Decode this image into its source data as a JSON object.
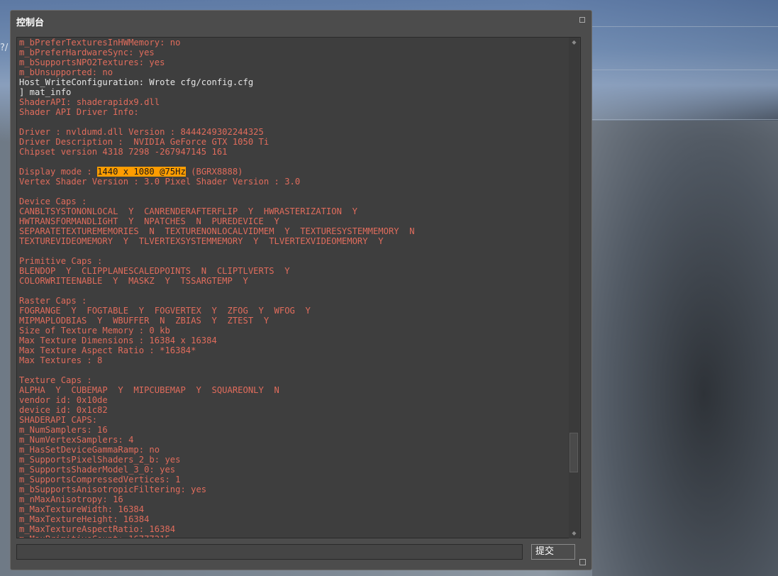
{
  "window": {
    "title": "控制台",
    "submit_label": "提交",
    "input_value": "",
    "highlight_color": "#ff9d00",
    "text_color": "#e06c5c"
  },
  "background": {
    "left_glyph": "?/",
    "bottom_text": "~ ~ ~ ~ ~ ~"
  },
  "log": [
    {
      "t": "m_bPreferTexturesInHWMemory: no"
    },
    {
      "t": "m_bPreferHardwareSync: yes"
    },
    {
      "t": "m_bSupportsNPO2Textures: yes"
    },
    {
      "t": "m_bUnsupported: no"
    },
    {
      "t": "Host_WriteConfiguration: Wrote cfg/config.cfg",
      "white": true
    },
    {
      "t": "] mat_info",
      "white": true
    },
    {
      "t": "ShaderAPI: shaderapidx9.dll"
    },
    {
      "t": "Shader API Driver Info:"
    },
    {
      "t": ""
    },
    {
      "t": "Driver : nvldumd.dll Version : 8444249302244325"
    },
    {
      "t": "Driver Description :  NVIDIA GeForce GTX 1050 Ti"
    },
    {
      "t": "Chipset version 4318 7298 -267947145 161"
    },
    {
      "t": ""
    },
    {
      "pre": "Display mode : ",
      "hl": "1440 x 1080 @75Hz",
      "post": " (BGRX8888)"
    },
    {
      "t": "Vertex Shader Version : 3.0 Pixel Shader Version : 3.0"
    },
    {
      "t": ""
    },
    {
      "t": "Device Caps :"
    },
    {
      "t": "CANBLTSYSTONONLOCAL  Y  CANRENDERAFTERFLIP  Y  HWRASTERIZATION  Y"
    },
    {
      "t": "HWTRANSFORMANDLIGHT  Y  NPATCHES  N  PUREDEVICE  Y"
    },
    {
      "t": "SEPARATETEXTUREMEMORIES  N  TEXTURENONLOCALVIDMEM  Y  TEXTURESYSTEMMEMORY  N"
    },
    {
      "t": "TEXTUREVIDEOMEMORY  Y  TLVERTEXSYSTEMMEMORY  Y  TLVERTEXVIDEOMEMORY  Y"
    },
    {
      "t": ""
    },
    {
      "t": "Primitive Caps :"
    },
    {
      "t": "BLENDOP  Y  CLIPPLANESCALEDPOINTS  N  CLIPTLVERTS  Y"
    },
    {
      "t": "COLORWRITEENABLE  Y  MASKZ  Y  TSSARGTEMP  Y"
    },
    {
      "t": ""
    },
    {
      "t": "Raster Caps :"
    },
    {
      "t": "FOGRANGE  Y  FOGTABLE  Y  FOGVERTEX  Y  ZFOG  Y  WFOG  Y"
    },
    {
      "t": "MIPMAPLODBIAS  Y  WBUFFER  N  ZBIAS  Y  ZTEST  Y"
    },
    {
      "t": "Size of Texture Memory : 0 kb"
    },
    {
      "t": "Max Texture Dimensions : 16384 x 16384"
    },
    {
      "t": "Max Texture Aspect Ratio : *16384*"
    },
    {
      "t": "Max Textures : 8"
    },
    {
      "t": ""
    },
    {
      "t": "Texture Caps :"
    },
    {
      "t": "ALPHA  Y  CUBEMAP  Y  MIPCUBEMAP  Y  SQUAREONLY  N"
    },
    {
      "t": "vendor id: 0x10de"
    },
    {
      "t": "device id: 0x1c82"
    },
    {
      "t": "SHADERAPI CAPS:"
    },
    {
      "t": "m_NumSamplers: 16"
    },
    {
      "t": "m_NumVertexSamplers: 4"
    },
    {
      "t": "m_HasSetDeviceGammaRamp: no"
    },
    {
      "t": "m_SupportsPixelShaders_2_b: yes"
    },
    {
      "t": "m_SupportsShaderModel_3_0: yes"
    },
    {
      "t": "m_SupportsCompressedVertices: 1"
    },
    {
      "t": "m_bSupportsAnisotropicFiltering: yes"
    },
    {
      "t": "m_nMaxAnisotropy: 16"
    },
    {
      "t": "m_MaxTextureWidth: 16384"
    },
    {
      "t": "m_MaxTextureHeight: 16384"
    },
    {
      "t": "m_MaxTextureAspectRatio: 16384"
    },
    {
      "t": "m_MaxPrimitiveCount: 16777215"
    }
  ]
}
